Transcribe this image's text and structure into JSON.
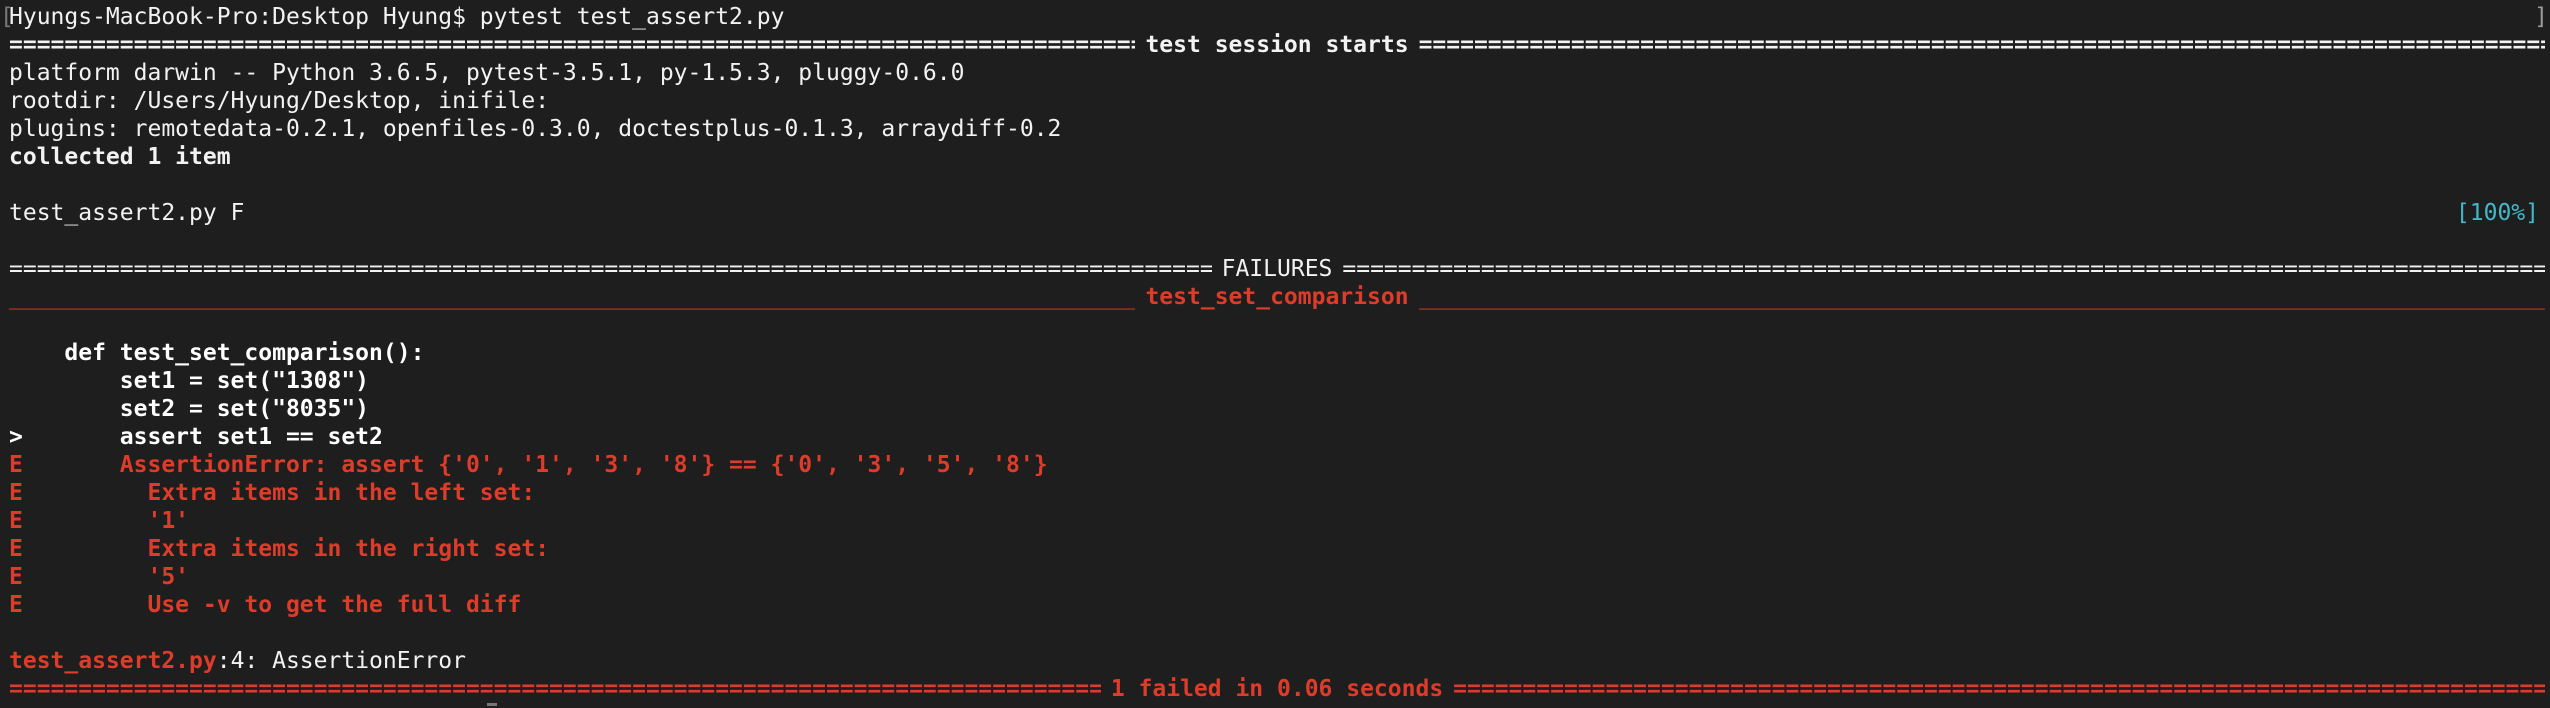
{
  "prompt_line": "Hyungs-MacBook-Pro:Desktop Hyung$ pytest test_assert2.py",
  "session": {
    "title": "test session starts",
    "platform": "platform darwin -- Python 3.6.5, pytest-3.5.1, py-1.5.3, pluggy-0.6.0",
    "rootdir": "rootdir: /Users/Hyung/Desktop, inifile:",
    "plugins": "plugins: remotedata-0.2.1, openfiles-0.3.0, doctestplus-0.1.3, arraydiff-0.2",
    "collected": "collected 1 item",
    "test_file": "test_assert2.py F",
    "progress": "[100%]"
  },
  "failures": {
    "title": "FAILURES",
    "test_name": "test_set_comparison",
    "code": [
      "    def test_set_comparison():",
      "        set1 = set(\"1308\")",
      "        set2 = set(\"8035\")",
      ">       assert set1 == set2"
    ],
    "errors": [
      "E       AssertionError: assert {'0', '1', '3', '8'} == {'0', '3', '5', '8'}",
      "E         Extra items in the left set:",
      "E         '1'",
      "E         Extra items in the right set:",
      "E         '5'",
      "E         Use -v to get the full diff"
    ],
    "location_file": "test_assert2.py",
    "location_rest": ":4: AssertionError"
  },
  "summary": "1 failed in 0.06 seconds",
  "edge_mark": "]",
  "colors": {
    "background": "#1e1e1e",
    "text": "#f2f2f2",
    "error_red": "#de3c2a",
    "progress_cyan": "#42b9c8"
  }
}
